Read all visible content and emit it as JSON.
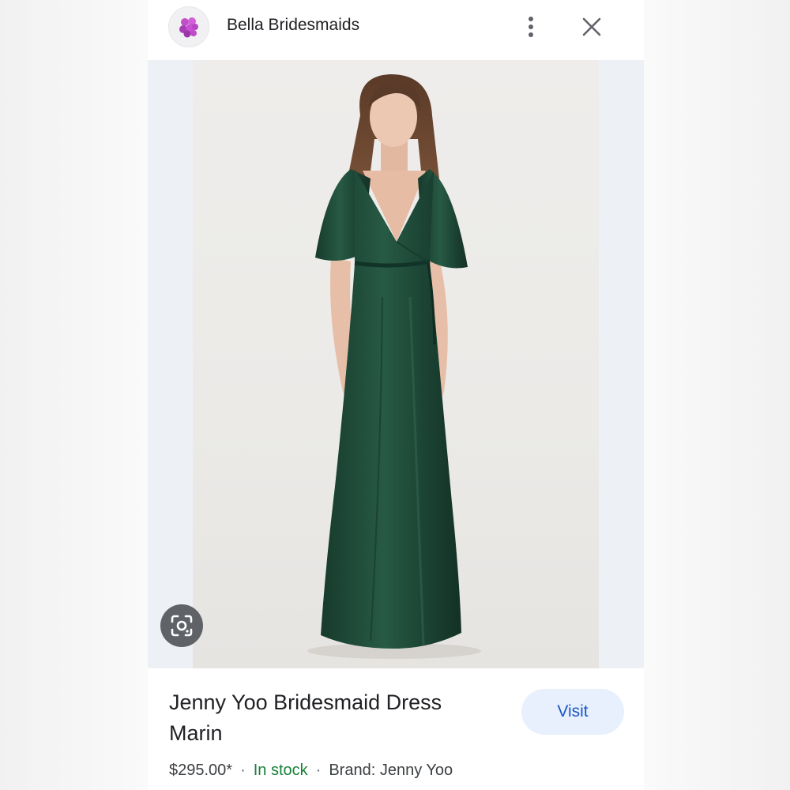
{
  "header": {
    "site_name": "Bella Bridesmaids",
    "favicon_icon": "flower-bouquet-icon",
    "menu_icon": "more-vert-icon",
    "close_icon": "close-icon"
  },
  "image": {
    "subject": "dress-photo",
    "lens_icon": "lens-search-icon"
  },
  "product": {
    "title": "Jenny Yoo Bridesmaid Dress Marin",
    "visit_label": "Visit",
    "price": "$295.00*",
    "separator": "·",
    "stock": "In stock",
    "brand": "Brand: Jenny Yoo"
  },
  "colors": {
    "stock_green": "#188038",
    "visit_bg": "#e8f0fe",
    "visit_text": "#1a56c4",
    "dress_green": "#1f4a38"
  }
}
